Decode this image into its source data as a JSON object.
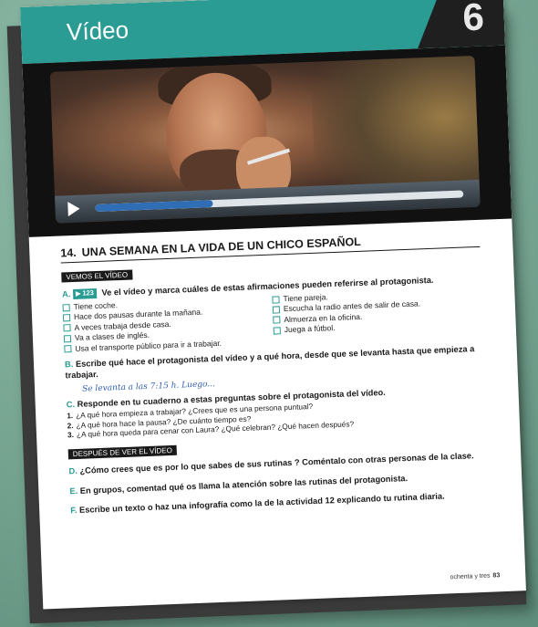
{
  "header": {
    "title": "Vídeo",
    "chapter": "6"
  },
  "video": {
    "progress": 0.32
  },
  "activity": {
    "number": "14.",
    "title": "UNA SEMANA EN LA VIDA DE UN CHICO ESPAÑOL",
    "section1_label": "VEMOS EL VÍDEO",
    "taskA": {
      "letter": "A.",
      "badge": "123",
      "text": "Ve el vídeo y marca cuáles de estas afirmaciones pueden referirse al protagonista."
    },
    "checks_left": [
      "Tiene coche.",
      "Hace dos pausas durante la mañana.",
      "A veces trabaja desde casa.",
      "Va a clases de inglés.",
      "Usa el transporte público para ir a trabajar."
    ],
    "checks_right": [
      "Tiene pareja.",
      "Escucha la radio antes de salir de casa.",
      "Almuerza en la oficina.",
      "Juega a fútbol."
    ],
    "taskB": {
      "letter": "B.",
      "text": "Escribe qué hace el protagonista del vídeo y a qué hora, desde que se levanta hasta que empieza a trabajar."
    },
    "handwriting": "Se levanta a las 7:15 h. Luego...",
    "taskC": {
      "letter": "C.",
      "text": "Responde en tu cuaderno a estas preguntas sobre el protagonista del vídeo."
    },
    "questions": [
      {
        "n": "1.",
        "text": "¿A qué hora empieza a trabajar? ¿Crees que es una persona puntual?"
      },
      {
        "n": "2.",
        "text": "¿A qué hora hace la pausa? ¿De cuánto tiempo es?"
      },
      {
        "n": "3.",
        "text": "¿A qué hora queda para cenar con Laura? ¿Qué celebran? ¿Qué hacen después?"
      }
    ],
    "section2_label": "DESPUÉS DE VER EL VÍDEO",
    "taskD": {
      "letter": "D.",
      "text": "¿Cómo crees que es por lo que sabes de sus rutinas ? Coméntalo con otras personas de la clase."
    },
    "taskE": {
      "letter": "E.",
      "text": "En grupos, comentad qué os llama la atención sobre las rutinas del protagonista."
    },
    "taskF": {
      "letter": "F.",
      "text": "Escribe un texto o haz una infografía como la de la actividad 12 explicando tu rutina diaria."
    }
  },
  "footer": {
    "text": "ochenta y tres",
    "page": "83"
  }
}
